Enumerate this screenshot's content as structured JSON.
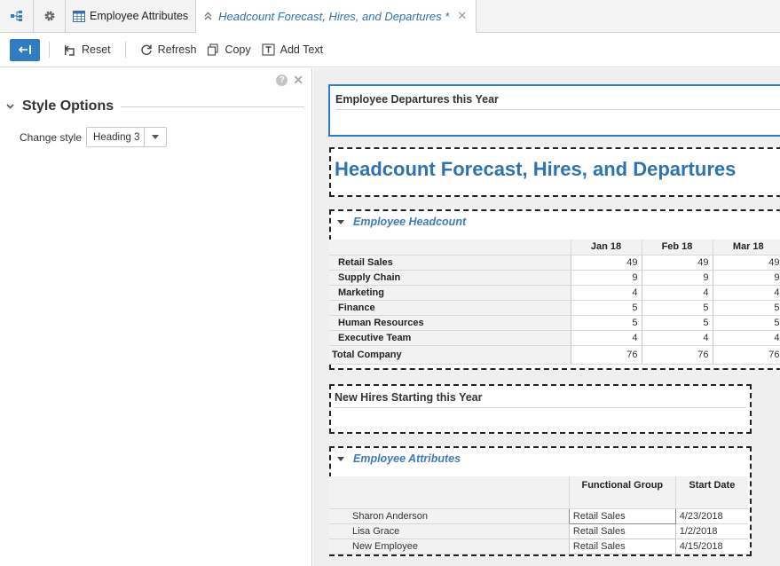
{
  "tabs": [
    {
      "label": "",
      "icon": "hierarchy-icon"
    },
    {
      "label": "",
      "icon": "gear-icon"
    },
    {
      "label": "Employee Attributes",
      "icon": "table-icon"
    },
    {
      "label": "Headcount Forecast, Hires, and Departures *",
      "icon": "pin-icon",
      "active": true
    }
  ],
  "toolbar": {
    "reset": "Reset",
    "refresh": "Refresh",
    "copy": "Copy",
    "add_text": "Add Text"
  },
  "left_panel": {
    "section_title": "Style Options",
    "change_style_label": "Change style",
    "change_style_value": "Heading 3"
  },
  "canvas": {
    "departures_title": "Employee Departures this Year",
    "heading": "Headcount Forecast, Hires, and Departures",
    "headcount": {
      "title": "Employee Headcount",
      "columns": [
        "Jan 18",
        "Feb 18",
        "Mar 18"
      ],
      "rows": [
        {
          "label": "Retail Sales",
          "values": [
            "49",
            "49",
            "49"
          ]
        },
        {
          "label": "Supply Chain",
          "values": [
            "9",
            "9",
            "9"
          ]
        },
        {
          "label": "Marketing",
          "values": [
            "4",
            "4",
            "4"
          ]
        },
        {
          "label": "Finance",
          "values": [
            "5",
            "5",
            "5"
          ]
        },
        {
          "label": "Human Resources",
          "values": [
            "5",
            "5",
            "5"
          ]
        },
        {
          "label": "Executive Team",
          "values": [
            "4",
            "4",
            "4"
          ]
        }
      ],
      "total": {
        "label": "Total Company",
        "values": [
          "76",
          "76",
          "76"
        ]
      }
    },
    "new_hires_title": "New Hires Starting this Year",
    "attributes": {
      "title": "Employee Attributes",
      "columns": [
        "Functional Group",
        "Start Date"
      ],
      "rows": [
        {
          "name": "Sharon Anderson",
          "group": "Retail Sales",
          "date": "4/23/2018"
        },
        {
          "name": "Lisa Grace",
          "group": "Retail Sales",
          "date": "1/2/2018"
        },
        {
          "name": "New Employee",
          "group": "Retail Sales",
          "date": "4/15/2018"
        }
      ]
    }
  },
  "colors": {
    "accent": "#2f7cc4",
    "heading": "#2f72b0"
  }
}
